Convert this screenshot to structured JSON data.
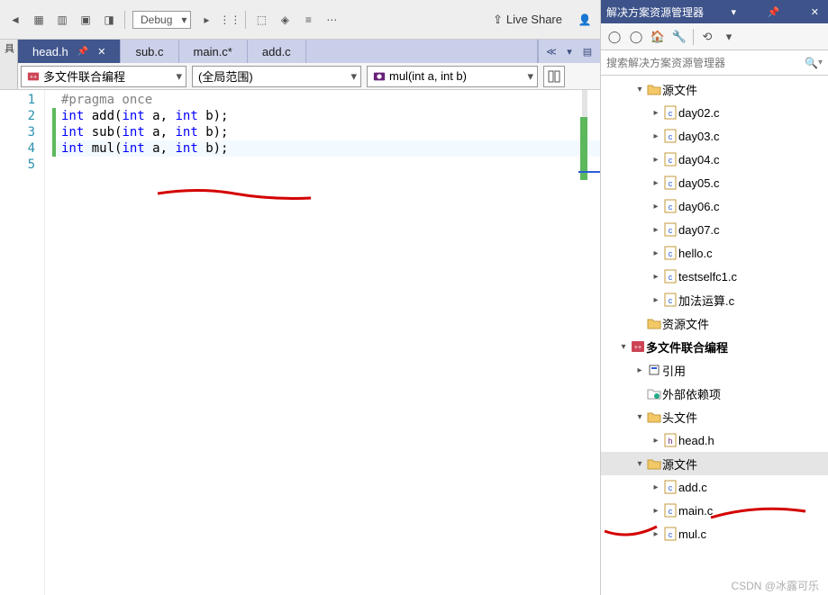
{
  "toolbar": {
    "config_label": "Debug",
    "live_share_label": "Live Share"
  },
  "tabs": [
    {
      "label": "head.h",
      "active": true,
      "pinned": true
    },
    {
      "label": "sub.c",
      "active": false
    },
    {
      "label": "main.c*",
      "active": false
    },
    {
      "label": "add.c",
      "active": false
    }
  ],
  "sidebar_vertical_tab": "工具箱",
  "context": {
    "project": "多文件联合编程",
    "scope": "(全局范围)",
    "member": "mul(int a, int b)"
  },
  "code": {
    "lines": [
      {
        "n": 1,
        "pp": "#pragma once",
        "bar": false
      },
      {
        "n": 2,
        "text": "",
        "bar": false
      },
      {
        "n": 3,
        "kw1": "int",
        "name": " add(",
        "kw2": "int",
        "mid": " a, ",
        "kw3": "int",
        "end": " b);",
        "bar": true
      },
      {
        "n": 4,
        "kw1": "int",
        "name": " sub(",
        "kw2": "int",
        "mid": " a, ",
        "kw3": "int",
        "end": " b);",
        "bar": true
      },
      {
        "n": 5,
        "kw1": "int",
        "name": " mul(",
        "kw2": "int",
        "mid": " a, ",
        "kw3": "int",
        "end": " b);",
        "bar": true,
        "hl": true
      }
    ]
  },
  "solution_explorer": {
    "title": "解决方案资源管理器",
    "search_placeholder": "搜索解决方案资源管理器",
    "tree": [
      {
        "depth": 1,
        "expand": "▾",
        "icon": "folder",
        "label": "源文件"
      },
      {
        "depth": 2,
        "expand": "▸",
        "icon": "c",
        "label": "day02.c"
      },
      {
        "depth": 2,
        "expand": "▸",
        "icon": "c",
        "label": "day03.c"
      },
      {
        "depth": 2,
        "expand": "▸",
        "icon": "c",
        "label": "day04.c"
      },
      {
        "depth": 2,
        "expand": "▸",
        "icon": "c",
        "label": "day05.c"
      },
      {
        "depth": 2,
        "expand": "▸",
        "icon": "c",
        "label": "day06.c"
      },
      {
        "depth": 2,
        "expand": "▸",
        "icon": "c",
        "label": "day07.c"
      },
      {
        "depth": 2,
        "expand": "▸",
        "icon": "c",
        "label": "hello.c"
      },
      {
        "depth": 2,
        "expand": "▸",
        "icon": "c",
        "label": "testselfc1.c"
      },
      {
        "depth": 2,
        "expand": "▸",
        "icon": "c",
        "label": "加法运算.c"
      },
      {
        "depth": 1,
        "expand": "",
        "icon": "folder",
        "label": "资源文件"
      },
      {
        "depth": 0,
        "expand": "▾",
        "icon": "proj",
        "label": "多文件联合编程",
        "bold": true
      },
      {
        "depth": 1,
        "expand": "▸",
        "icon": "ref",
        "label": "引用"
      },
      {
        "depth": 1,
        "expand": "",
        "icon": "ext",
        "label": "外部依赖项"
      },
      {
        "depth": 1,
        "expand": "▾",
        "icon": "folder",
        "label": "头文件"
      },
      {
        "depth": 2,
        "expand": "▸",
        "icon": "h",
        "label": "head.h"
      },
      {
        "depth": 1,
        "expand": "▾",
        "icon": "folder",
        "label": "源文件",
        "selected": true
      },
      {
        "depth": 2,
        "expand": "▸",
        "icon": "c",
        "label": "add.c"
      },
      {
        "depth": 2,
        "expand": "▸",
        "icon": "c",
        "label": "main.c"
      },
      {
        "depth": 2,
        "expand": "▸",
        "icon": "c",
        "label": "mul.c"
      }
    ]
  },
  "watermark": "CSDN @冰露可乐"
}
